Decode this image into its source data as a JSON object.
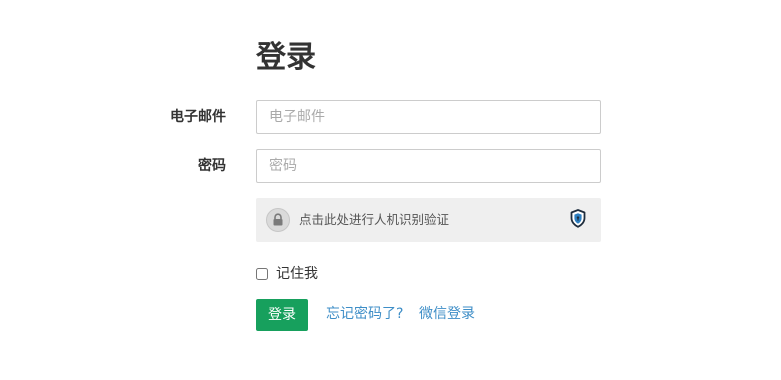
{
  "form": {
    "title": "登录",
    "email": {
      "label": "电子邮件",
      "placeholder": "电子邮件",
      "value": ""
    },
    "password": {
      "label": "密码",
      "placeholder": "密码",
      "value": ""
    },
    "captcha": {
      "text": "点击此处进行人机识别验证",
      "lock_icon": "lock-icon",
      "shield_icon": "shield-icon"
    },
    "remember_me": {
      "label": "记住我",
      "checked": false
    },
    "login_button_label": "登录",
    "forgot_password_link": "忘记密码了?",
    "wechat_login_link": "微信登录"
  },
  "colors": {
    "primary_green": "#17a05d",
    "link_blue": "#3e8ec7",
    "captcha_background": "#efefef",
    "input_border": "#cccccc"
  }
}
